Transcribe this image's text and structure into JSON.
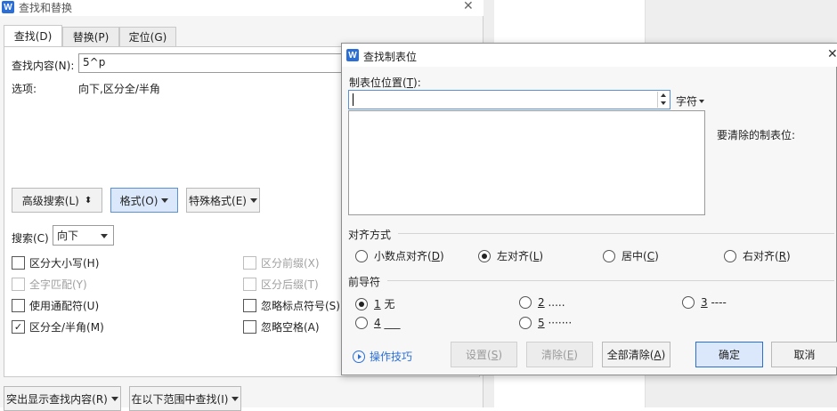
{
  "main_dialog": {
    "title": "查找和替换",
    "close_symbol": "✕",
    "tabs": [
      {
        "label": "查找(D)"
      },
      {
        "label": "替换(P)"
      },
      {
        "label": "定位(G)"
      }
    ],
    "find_label": "查找内容(N):",
    "find_value": "5^p",
    "options_label": "选项:",
    "options_value": "向下,区分全/半角",
    "advanced_search_label": "高级搜索(L)",
    "advanced_arrow": "⬍",
    "format_label": "格式(O)",
    "special_format_label": "特殊格式(E)",
    "search_label": "搜索(C)",
    "search_direction": "向下",
    "checkboxes": [
      {
        "label": "区分大小写(H)",
        "checked": false,
        "enabled": true
      },
      {
        "label": "全字匹配(Y)",
        "checked": false,
        "enabled": false
      },
      {
        "label": "使用通配符(U)",
        "checked": false,
        "enabled": true
      },
      {
        "label": "区分全/半角(M)",
        "checked": true,
        "enabled": true
      },
      {
        "label": "区分前缀(X)",
        "checked": false,
        "enabled": false
      },
      {
        "label": "区分后缀(T)",
        "checked": false,
        "enabled": false
      },
      {
        "label": "忽略标点符号(S)",
        "checked": false,
        "enabled": true
      },
      {
        "label": "忽略空格(A)",
        "checked": false,
        "enabled": true
      }
    ],
    "highlight_label": "突出显示查找内容(R)",
    "find_in_label": "在以下范围中查找(I)"
  },
  "tab_dialog": {
    "title": "查找制表位",
    "close_symbol": "✕",
    "logo": "W",
    "position_label_pre": "制表位位置(",
    "position_label_key": "T",
    "position_label_post": "):",
    "position_value": "",
    "unit_label": "字符",
    "clear_label": "要清除的制表位:",
    "alignment_group": "对齐方式",
    "alignments": [
      {
        "text": "小数点对齐(",
        "key": "D",
        "end": ")",
        "selected": false
      },
      {
        "text": "左对齐(",
        "key": "L",
        "end": ")",
        "selected": true
      },
      {
        "text": "居中(",
        "key": "C",
        "end": ")",
        "selected": false
      },
      {
        "text": "右对齐(",
        "key": "R",
        "end": ")",
        "selected": false
      }
    ],
    "leader_group": "前导符",
    "leaders": [
      {
        "num": "1",
        "text": " 无",
        "selected": true
      },
      {
        "num": "2",
        "text": " .....",
        "selected": false
      },
      {
        "num": "3",
        "text": " ----",
        "selected": false
      },
      {
        "num": "4",
        "text": " ___",
        "selected": false
      },
      {
        "num": "5",
        "text": " ·······",
        "selected": false
      }
    ],
    "tips_label": "操作技巧",
    "set_label_pre": "设置(",
    "set_label_key": "S",
    "set_label_post": ")",
    "clear_btn_pre": "清除(",
    "clear_btn_key": "E",
    "clear_btn_post": ")",
    "clear_all_pre": "全部清除(",
    "clear_all_key": "A",
    "clear_all_post": ")",
    "ok_label": "确定",
    "cancel_label": "取消"
  },
  "colors": {
    "accent_blue": "#2b6fd6",
    "selected_button": "#dbe8fb"
  }
}
